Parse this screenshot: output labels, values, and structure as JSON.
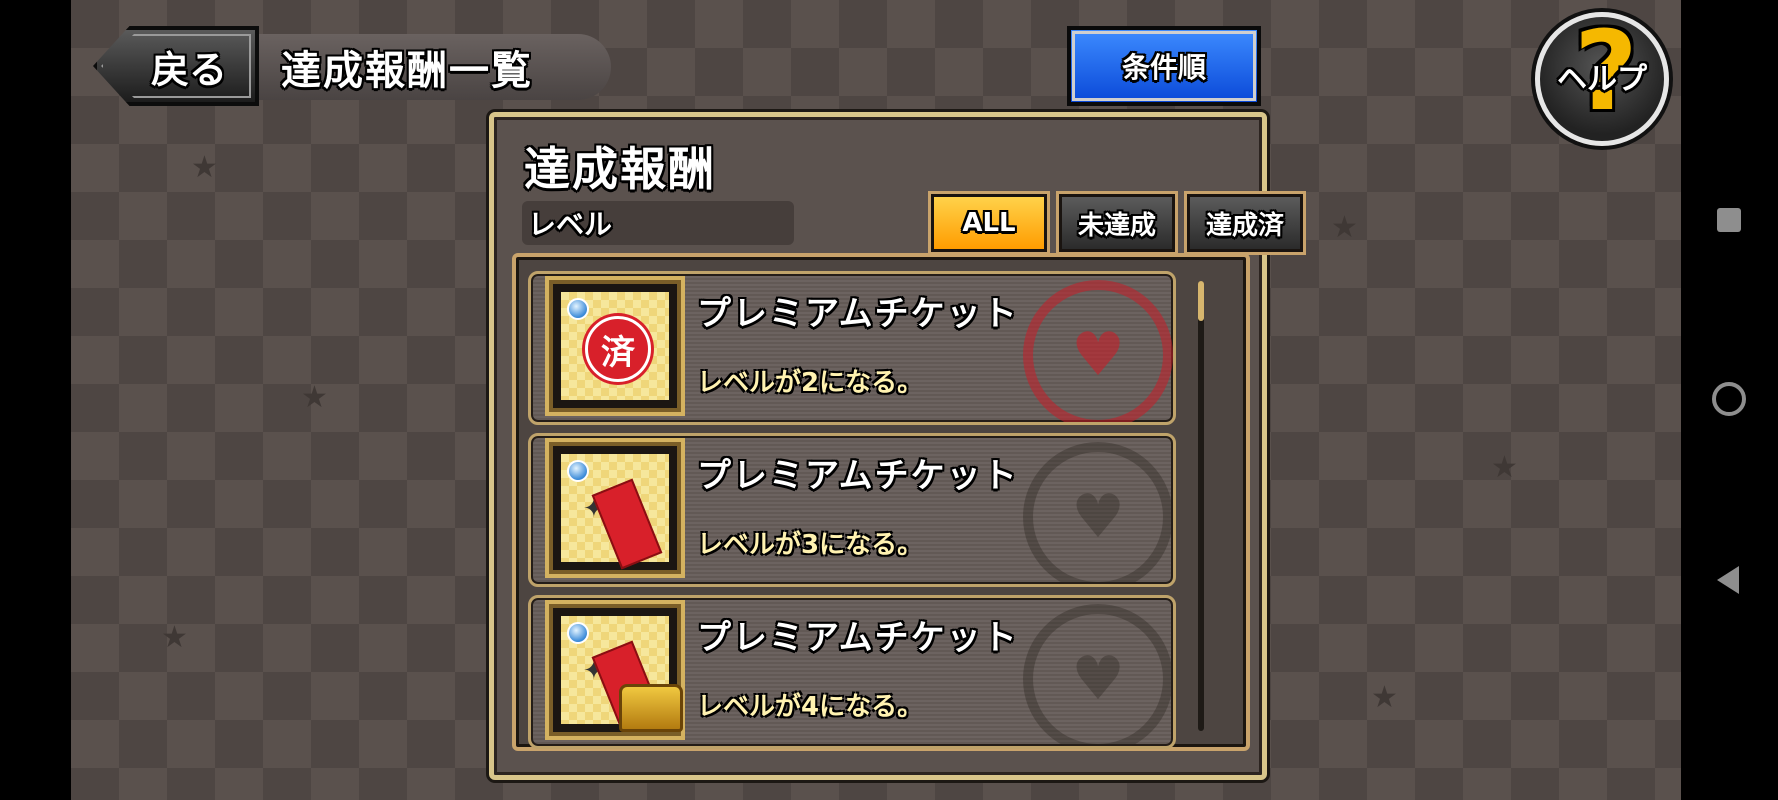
{
  "header": {
    "back_label": "戻る",
    "screen_title": "達成報酬一覧",
    "sort_label": "条件順",
    "help_label": "ヘルプ"
  },
  "panel": {
    "title": "達成報酬",
    "category": "レベル",
    "tabs": [
      {
        "label": "ALL",
        "selected": true
      },
      {
        "label": "未達成",
        "selected": false
      },
      {
        "label": "達成済",
        "selected": false
      }
    ]
  },
  "rewards": [
    {
      "name": "プレミアムチケット",
      "condition": "レベルが2になる。",
      "claimed": true,
      "stamp": "済"
    },
    {
      "name": "プレミアムチケット",
      "condition": "レベルが3になる。",
      "claimed": false
    },
    {
      "name": "プレミアムチケット",
      "condition": "レベルが4になる。",
      "claimed": false
    }
  ],
  "icons": {
    "back": "back-arrow-icon",
    "help": "question-mark-icon",
    "reward": "premium-ticket-icon",
    "claimed": "claimed-stamp-icon",
    "chest": "treasure-chest-icon",
    "seal": "heart-slipper-seal-icon"
  },
  "colors": {
    "sort_button": "#1a5cf0",
    "tab_selected": "#ffb300",
    "panel_border": "#d8c58a",
    "claimed_stamp": "#d8202a"
  }
}
